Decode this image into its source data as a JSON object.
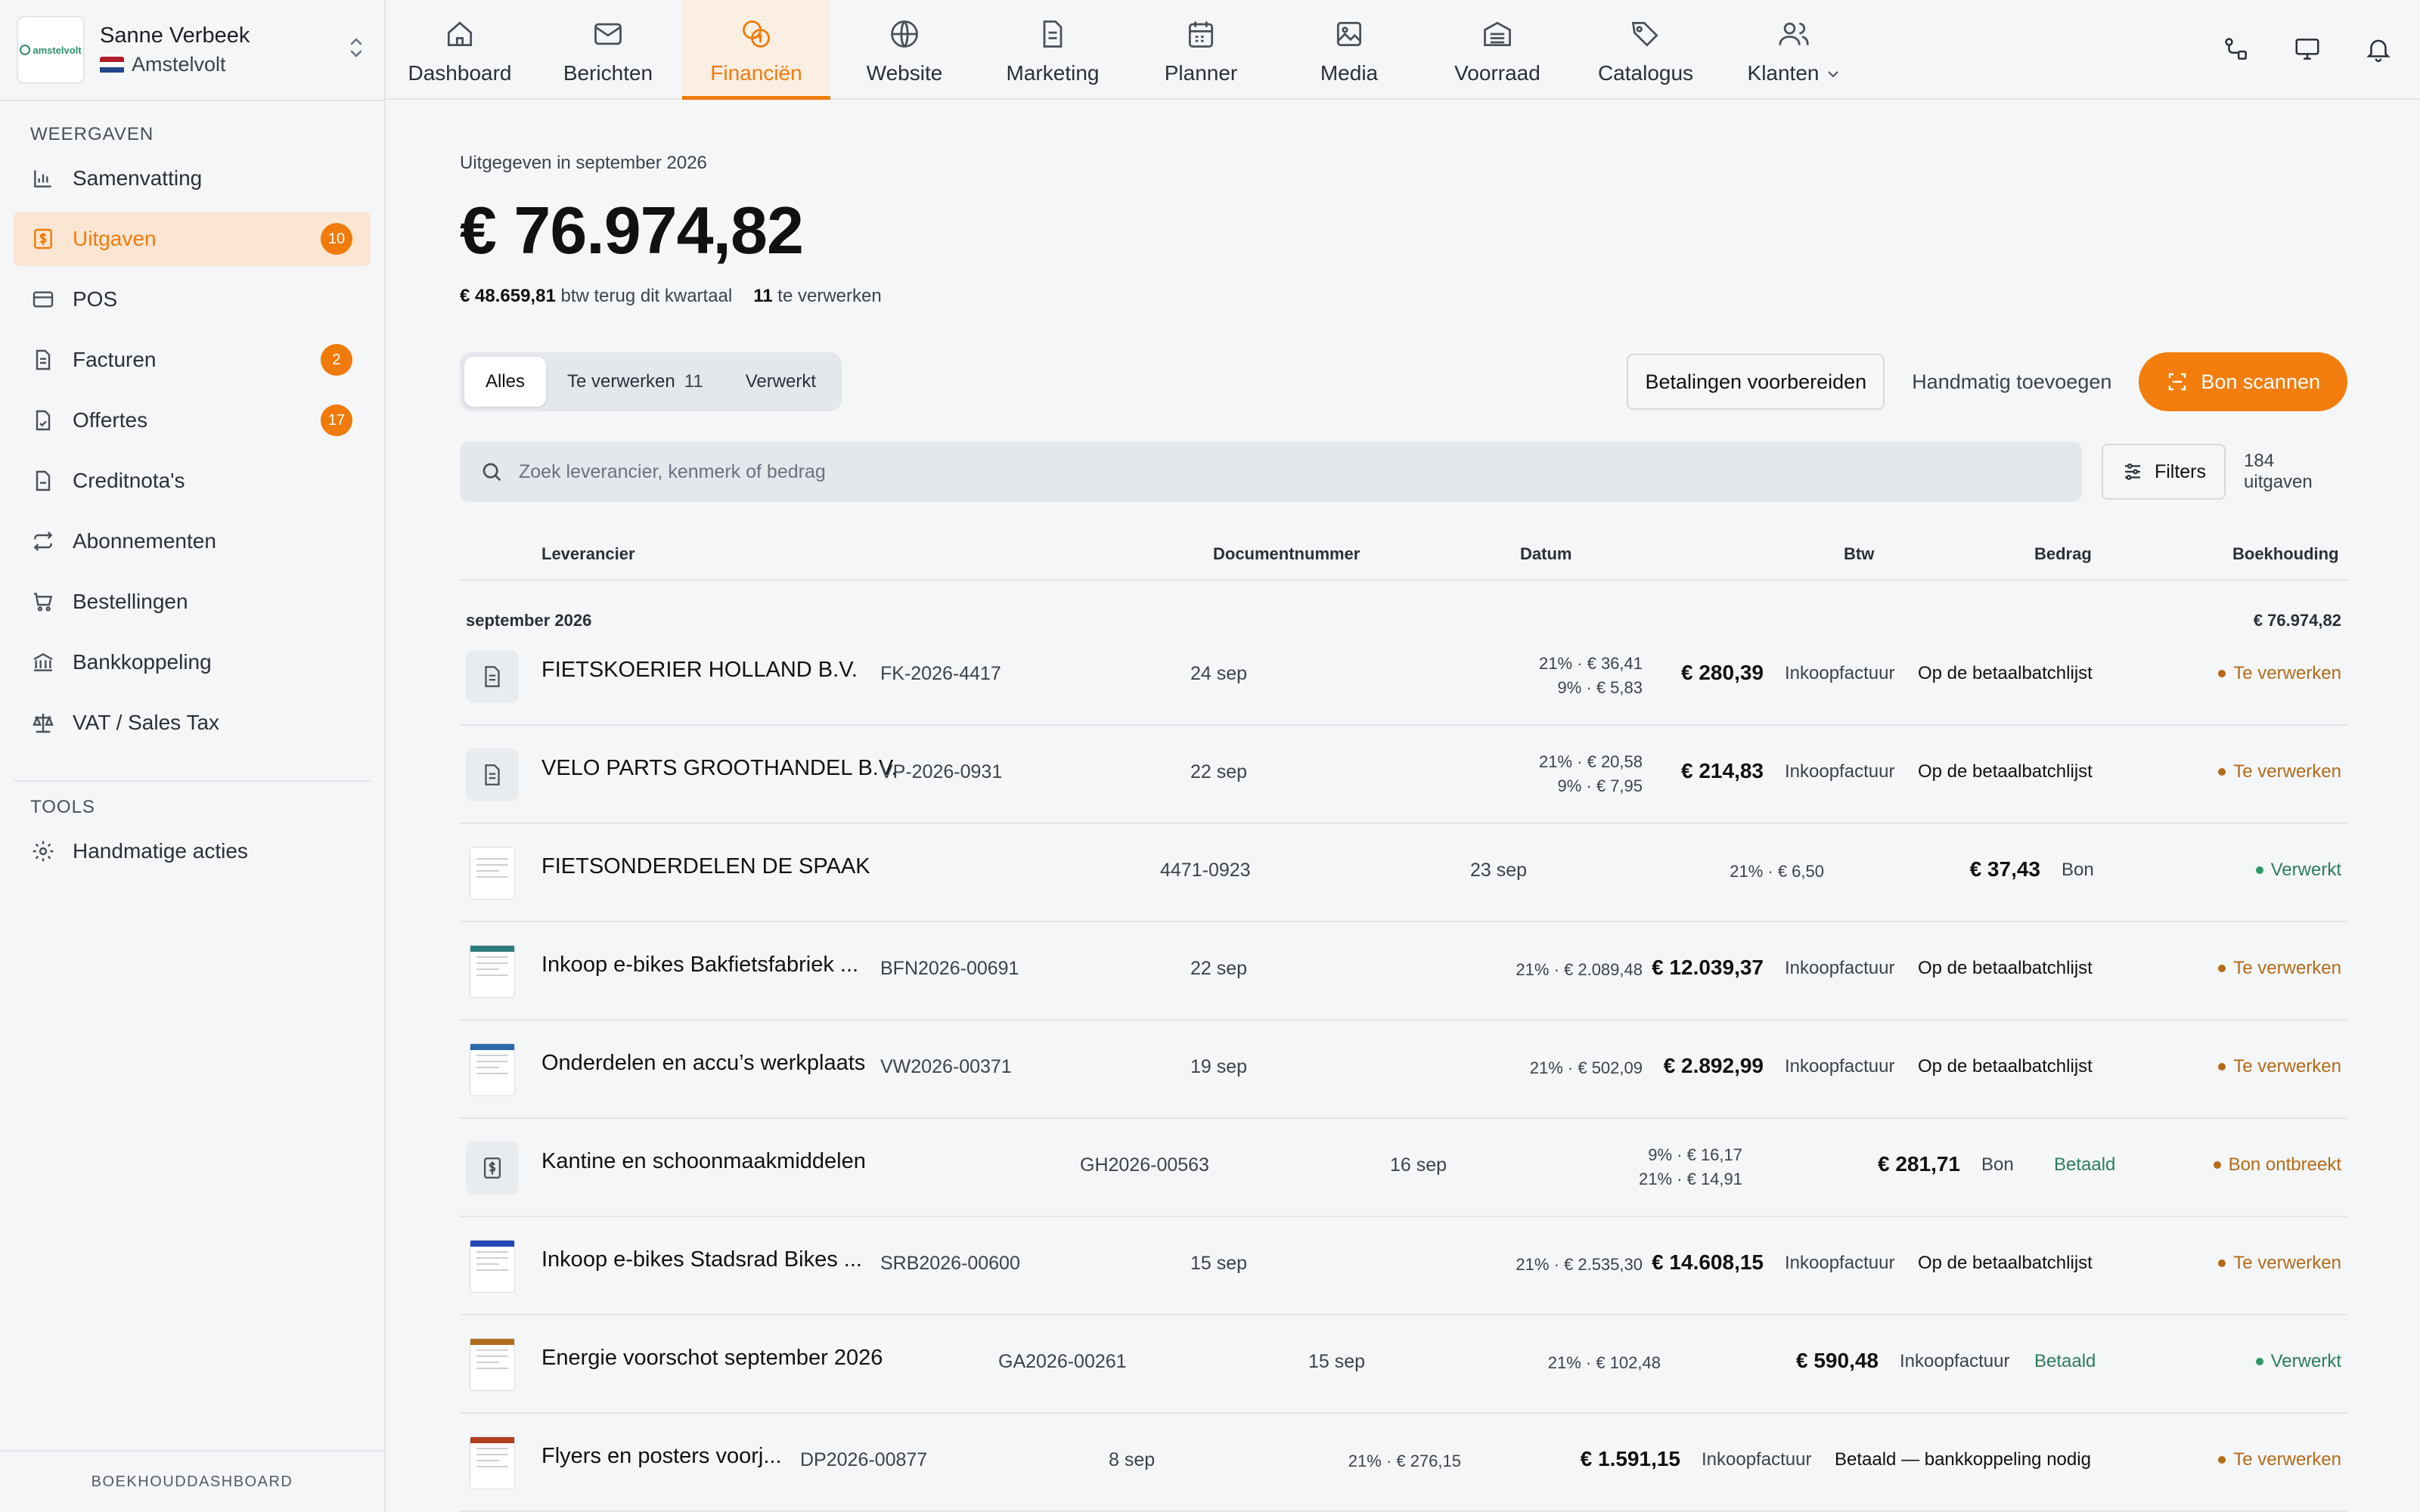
{
  "account": {
    "name": "Sanne Verbeek",
    "company": "Amstelvolt",
    "logo_text": "amstelvolt"
  },
  "sidebar": {
    "section_views": "WEERGAVEN",
    "items": [
      {
        "label": "Samenvatting",
        "icon": "bar-chart-icon",
        "badge": ""
      },
      {
        "label": "Uitgaven",
        "icon": "dollar-doc-icon",
        "badge": "10"
      },
      {
        "label": "POS",
        "icon": "card-icon",
        "badge": ""
      },
      {
        "label": "Facturen",
        "icon": "document-icon",
        "badge": "2"
      },
      {
        "label": "Offertes",
        "icon": "document-icon",
        "badge": "17"
      },
      {
        "label": "Creditnota's",
        "icon": "document-icon",
        "badge": ""
      },
      {
        "label": "Abonnementen",
        "icon": "repeat-icon",
        "badge": ""
      },
      {
        "label": "Bestellingen",
        "icon": "cart-icon",
        "badge": ""
      },
      {
        "label": "Bankkoppeling",
        "icon": "bank-icon",
        "badge": ""
      },
      {
        "label": "VAT / Sales Tax",
        "icon": "scale-icon",
        "badge": ""
      }
    ],
    "section_tools": "TOOLS",
    "tools": [
      {
        "label": "Handmatige acties",
        "icon": "gear-icon"
      }
    ],
    "footer": "BOEKHOUDDASHBOARD"
  },
  "topnav": {
    "tabs": [
      {
        "label": "Dashboard",
        "icon": "home-icon"
      },
      {
        "label": "Berichten",
        "icon": "mail-icon"
      },
      {
        "label": "Financiën",
        "icon": "coins-icon"
      },
      {
        "label": "Website",
        "icon": "globe-icon"
      },
      {
        "label": "Marketing",
        "icon": "document-icon"
      },
      {
        "label": "Planner",
        "icon": "calendar-icon"
      },
      {
        "label": "Media",
        "icon": "image-icon"
      },
      {
        "label": "Voorraad",
        "icon": "warehouse-icon"
      },
      {
        "label": "Catalogus",
        "icon": "tags-icon"
      },
      {
        "label": "Klanten",
        "icon": "users-icon"
      }
    ],
    "active_tab": "Financiën"
  },
  "summary": {
    "kicker": "Uitgegeven in september 2026",
    "total": "€ 76.974,82",
    "vat_back_amount": "€ 48.659,81",
    "vat_back_label": "btw terug dit kwartaal",
    "to_process_count": "11",
    "to_process_label": "te verwerken"
  },
  "filters": {
    "segments": [
      {
        "label": "Alles",
        "count": ""
      },
      {
        "label": "Te verwerken",
        "count": "11"
      },
      {
        "label": "Verwerkt",
        "count": ""
      }
    ],
    "prepare_payments": "Betalingen voorbereiden",
    "add_manual": "Handmatig toevoegen",
    "scan_receipt": "Bon scannen",
    "search_placeholder": "Zoek leverancier, kenmerk of bedrag",
    "filters_label": "Filters",
    "result_count": "184 uitgaven"
  },
  "table": {
    "headers": {
      "vendor": "Leverancier",
      "docnr": "Documentnummer",
      "date": "Datum",
      "vat": "Btw",
      "amount": "Bedrag",
      "bookkeeping": "Boekhouding"
    },
    "group": {
      "label": "september 2026",
      "total": "€ 76.974,82"
    },
    "rows": [
      {
        "vendor": "FIETSKOERIER HOLLAND B.V.",
        "docnr": "FK-2026-4417",
        "date": "24 sep",
        "vat1": "21% · € 36,41",
        "vat2": "9% · € 5,83",
        "amount": "€ 280,39",
        "type": "Inkoopfactuur",
        "payment": "Op de betaalbatchlijst",
        "status": "Te verwerken"
      },
      {
        "vendor": "VELO PARTS GROOTHANDEL B.V.",
        "docnr": "VP-2026-0931",
        "date": "22 sep",
        "vat1": "21% · € 20,58",
        "vat2": "9% · € 7,95",
        "amount": "€ 214,83",
        "type": "Inkoopfactuur",
        "payment": "Op de betaalbatchlijst",
        "status": "Te verwerken"
      },
      {
        "vendor": "FIETSONDERDELEN DE SPAAK",
        "docnr": "4471-0923",
        "date": "23 sep",
        "vat1": "21% · € 6,50",
        "vat2": "",
        "amount": "€ 37,43",
        "type": "Bon",
        "payment": "",
        "status": "Verwerkt"
      },
      {
        "vendor": "Inkoop e-bikes Bakfietsfabriek ...",
        "docnr": "BFN2026-00691",
        "date": "22 sep",
        "vat1": "21% · € 2.089,48",
        "vat2": "",
        "amount": "€ 12.039,37",
        "type": "Inkoopfactuur",
        "payment": "Op de betaalbatchlijst",
        "status": "Te verwerken"
      },
      {
        "vendor": "Onderdelen en accu’s werkplaats",
        "docnr": "VW2026-00371",
        "date": "19 sep",
        "vat1": "21% · € 502,09",
        "vat2": "",
        "amount": "€ 2.892,99",
        "type": "Inkoopfactuur",
        "payment": "Op de betaalbatchlijst",
        "status": "Te verwerken"
      },
      {
        "vendor": "Kantine en schoonmaakmiddelen",
        "docnr": "GH2026-00563",
        "date": "16 sep",
        "vat1": "9% · € 16,17",
        "vat2": "21% · € 14,91",
        "amount": "€ 281,71",
        "type": "Bon",
        "payment": "Betaald",
        "status": "Bon ontbreekt"
      },
      {
        "vendor": "Inkoop e-bikes Stadsrad Bikes ...",
        "docnr": "SRB2026-00600",
        "date": "15 sep",
        "vat1": "21% · € 2.535,30",
        "vat2": "",
        "amount": "€ 14.608,15",
        "type": "Inkoopfactuur",
        "payment": "Op de betaalbatchlijst",
        "status": "Te verwerken"
      },
      {
        "vendor": "Energie voorschot september 2026",
        "docnr": "GA2026-00261",
        "date": "15 sep",
        "vat1": "21% · € 102,48",
        "vat2": "",
        "amount": "€ 590,48",
        "type": "Inkoopfactuur",
        "payment": "Betaald",
        "status": "Verwerkt"
      },
      {
        "vendor": "Flyers en posters voorj...",
        "docnr": "DP2026-00877",
        "date": "8 sep",
        "vat1": "21% · € 276,15",
        "vat2": "",
        "amount": "€ 1.591,15",
        "type": "Inkoopfactuur",
        "payment": "Betaald — bankkoppeling nodig",
        "status": "Te verwerken"
      }
    ]
  },
  "colors": {
    "accent": "#f37d0d",
    "active_bg": "#fbe6d4",
    "pending": "#b46b18",
    "done": "#2d7d5a"
  }
}
